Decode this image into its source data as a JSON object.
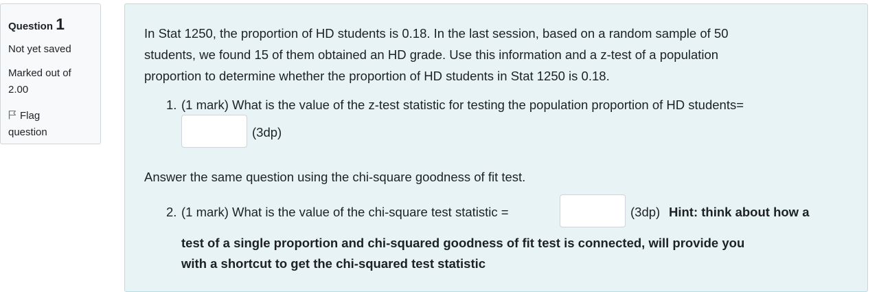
{
  "info": {
    "question_label": "Question",
    "question_number": "1",
    "state": "Not yet saved",
    "grade_line1": "Marked out of",
    "grade_line2": "2.00",
    "flag_line1": "Flag",
    "flag_line2": "question",
    "flag_icon": "flag-icon"
  },
  "question": {
    "intro_line1": "In Stat 1250, the proportion of HD students is 0.18. In the last session, based on a random sample of 50",
    "intro_line2": "students, we found 15 of them obtained an HD grade. Use this information and a z-test of a population",
    "intro_line3": "proportion to determine whether the proportion of HD students in Stat 1250 is 0.18.",
    "item1_number": "1.",
    "item1_text": "(1 mark) What is the value of the z-test statistic for testing the population proportion of HD students=",
    "item1_answer": "",
    "item1_suffix": "(3dp)",
    "chi_intro": "Answer the same question using the chi-square goodness of fit test.",
    "item2_number": "2.",
    "item2_text": "(1 mark) What is the value of the chi-square test statistic =",
    "item2_answer": "",
    "item2_suffix": "(3dp)",
    "hint_line1": "Hint: think about how a",
    "hint_line2": "test of a single proportion and chi-squared goodness of fit test is connected, will provide you",
    "hint_line3": "with a shortcut to get the chi-squared test statistic"
  }
}
